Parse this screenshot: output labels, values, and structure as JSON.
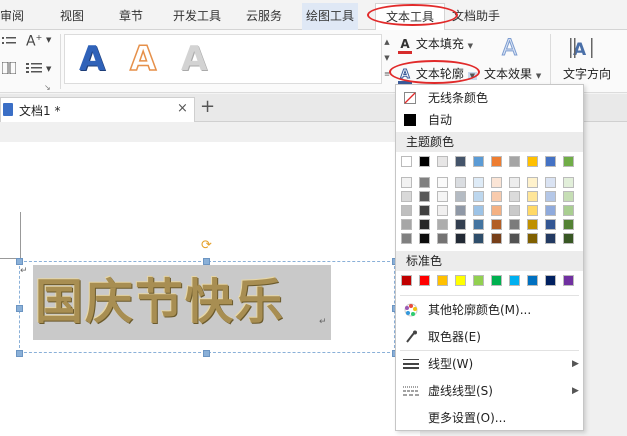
{
  "menu": {
    "tabs": [
      "审阅",
      "视图",
      "章节",
      "开发工具",
      "云服务",
      "绘图工具",
      "文本工具",
      "文档助手"
    ]
  },
  "ribbon": {
    "gallery_letters": [
      "A",
      "A",
      "A"
    ],
    "text_fill_label": "文本填充",
    "text_outline_label": "文本轮廓",
    "text_effect_label": "文本效果",
    "text_direction_label": "文字方向",
    "left_a_plus": "A",
    "left_a_sup": "+"
  },
  "document_tab": {
    "label": "文档1 *",
    "close": "×",
    "add": "+"
  },
  "art": {
    "text": "国庆节快乐",
    "para_mark": "↵"
  },
  "dropdown": {
    "no_line": "无线条颜色",
    "auto": "自动",
    "theme_colors_label": "主题颜色",
    "standard_colors_label": "标准色",
    "more_colors": "其他轮廓颜色(M)...",
    "eyedropper": "取色器(E)",
    "line_type": "线型(W)",
    "dash_type": "虚线线型(S)",
    "more_settings": "更多设置(O)..."
  },
  "colors": {
    "theme_top": [
      "#ffffff",
      "#000000",
      "#e7e6e6",
      "#44546a",
      "#5b9bd5",
      "#ed7d31",
      "#a5a5a5",
      "#ffc000",
      "#4472c4",
      "#70ad47"
    ],
    "standard": [
      "#c00000",
      "#ff0000",
      "#ffc000",
      "#ffff00",
      "#92d050",
      "#00b050",
      "#00b0f0",
      "#0070c0",
      "#002060",
      "#7030a0"
    ],
    "highlight": "#e12a2a"
  }
}
